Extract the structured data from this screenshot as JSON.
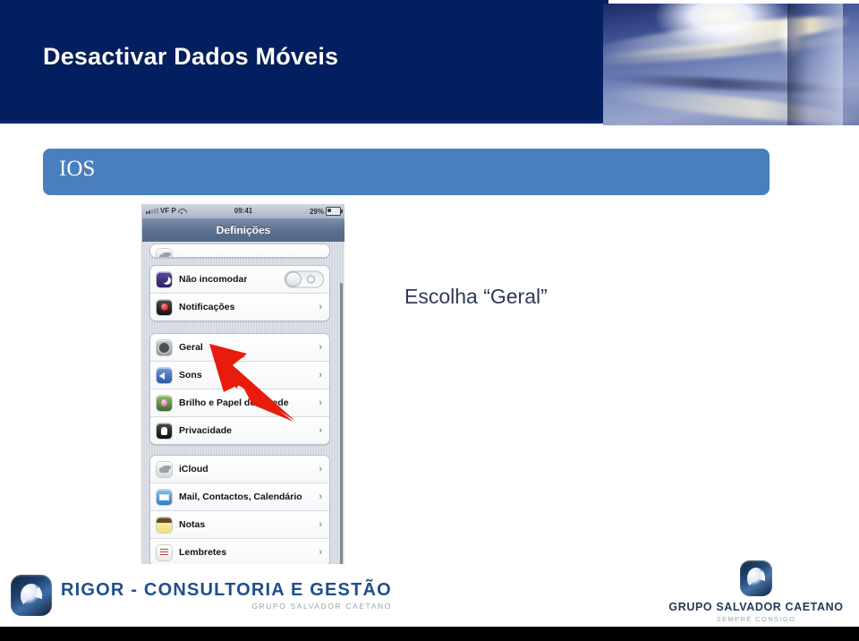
{
  "header": {
    "title": "Desactivar Dados Móveis",
    "navy_color": "#031f60",
    "image_name": "abstract-light-tunnel-image"
  },
  "section_banner": {
    "label": "IOS",
    "color": "#4a7fbf"
  },
  "callout": {
    "text": "Escolha “Geral”",
    "color": "#2e3a56"
  },
  "annotation": {
    "arrow_name": "red-arrow-pointing-to-geral",
    "color": "#e81c0c"
  },
  "phone": {
    "status_bar": {
      "carrier": "VF P",
      "time": "09:41",
      "battery": "29%",
      "signal_icon": "signal-bars-icon",
      "wifi_icon": "wifi-icon",
      "battery_icon": "battery-icon"
    },
    "nav_title": "Definições",
    "groups": [
      {
        "id": "group-partial",
        "rows": [
          {
            "label": "",
            "icon": "partial-row-icon",
            "accessory": "none"
          }
        ]
      },
      {
        "id": "group-a",
        "rows": [
          {
            "label": "Não incomodar",
            "icon": "moon-icon",
            "accessory": "toggle",
            "toggle_state": "off"
          },
          {
            "label": "Notificações",
            "icon": "notifications-icon",
            "accessory": "chevron"
          }
        ]
      },
      {
        "id": "group-b",
        "rows": [
          {
            "label": "Geral",
            "icon": "gear-icon",
            "accessory": "chevron"
          },
          {
            "label": "Sons",
            "icon": "speaker-icon",
            "accessory": "chevron"
          },
          {
            "label": "Brilho e Papel de parede",
            "icon": "brightness-wallpaper-icon",
            "accessory": "chevron"
          },
          {
            "label": "Privacidade",
            "icon": "privacy-hand-icon",
            "accessory": "chevron"
          }
        ]
      },
      {
        "id": "group-c",
        "rows": [
          {
            "label": "iCloud",
            "icon": "icloud-icon",
            "accessory": "chevron"
          },
          {
            "label": "Mail, Contactos, Calendário",
            "icon": "mail-icon",
            "accessory": "chevron"
          },
          {
            "label": "Notas",
            "icon": "notes-icon",
            "accessory": "chevron"
          },
          {
            "label": "Lembretes",
            "icon": "reminders-icon",
            "accessory": "chevron"
          }
        ]
      }
    ],
    "chevron_glyph": "›"
  },
  "footer": {
    "rigor": {
      "main": "RIGOR - CONSULTORIA E GESTÃO",
      "sub": "GRUPO SALVADOR CAETANO",
      "logo": "rigor-logo"
    },
    "gsc": {
      "main": "GRUPO SALVADOR CAETANO",
      "sub": "SEMPRE CONSIGO",
      "logo": "grupo-salvador-caetano-logo"
    }
  }
}
